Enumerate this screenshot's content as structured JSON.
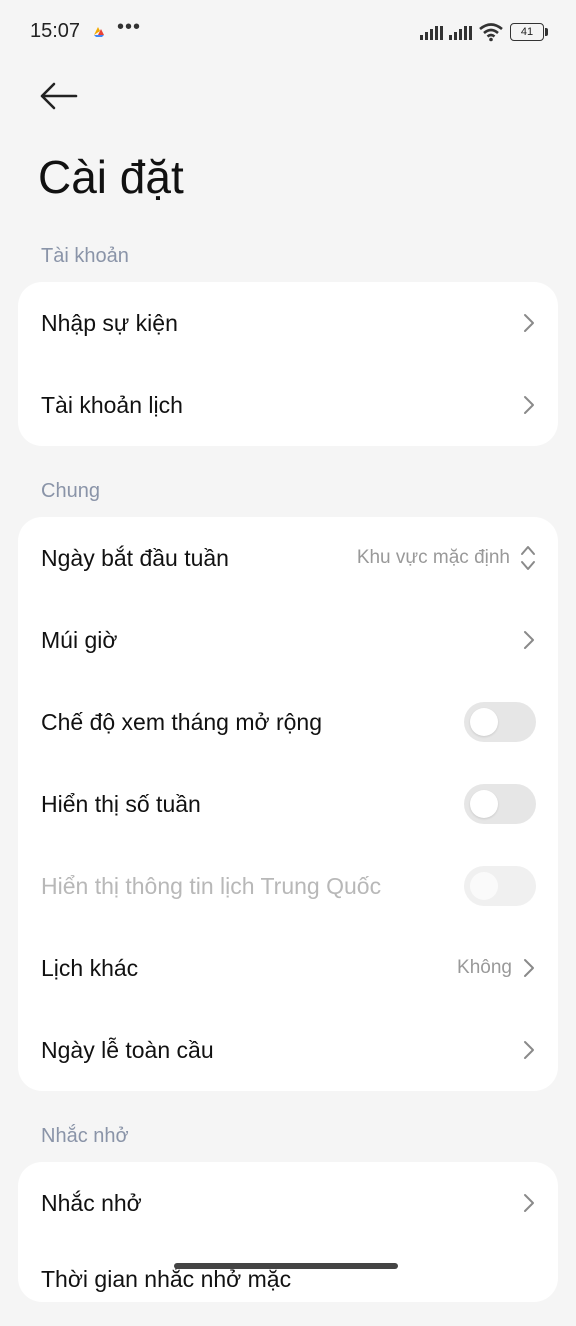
{
  "status": {
    "time": "15:07",
    "more": "•••",
    "battery": "41"
  },
  "header": {
    "back_icon": "arrow-left-icon",
    "title": "Cài đặt"
  },
  "sections": {
    "account": {
      "label": "Tài khoản",
      "items": [
        {
          "label": "Nhập sự kiện"
        },
        {
          "label": "Tài khoản lịch"
        }
      ]
    },
    "general": {
      "label": "Chung",
      "week_start": {
        "label": "Ngày bắt đầu tuần",
        "value": "Khu vực mặc định"
      },
      "timezone": {
        "label": "Múi giờ"
      },
      "extended_month": {
        "label": "Chế độ xem tháng mở rộng",
        "enabled": false
      },
      "week_numbers": {
        "label": "Hiển thị số tuần",
        "enabled": false
      },
      "chinese_calendar": {
        "label": "Hiển thị thông tin lịch Trung Quốc",
        "enabled": false,
        "disabled": true
      },
      "other_calendar": {
        "label": "Lịch khác",
        "value": "Không"
      },
      "global_holidays": {
        "label": "Ngày lễ toàn cầu"
      }
    },
    "reminders": {
      "label": "Nhắc nhở",
      "reminder": {
        "label": "Nhắc nhở"
      },
      "reminder_time_partial": {
        "label": "Thời gian nhắc nhở mặc"
      }
    }
  }
}
